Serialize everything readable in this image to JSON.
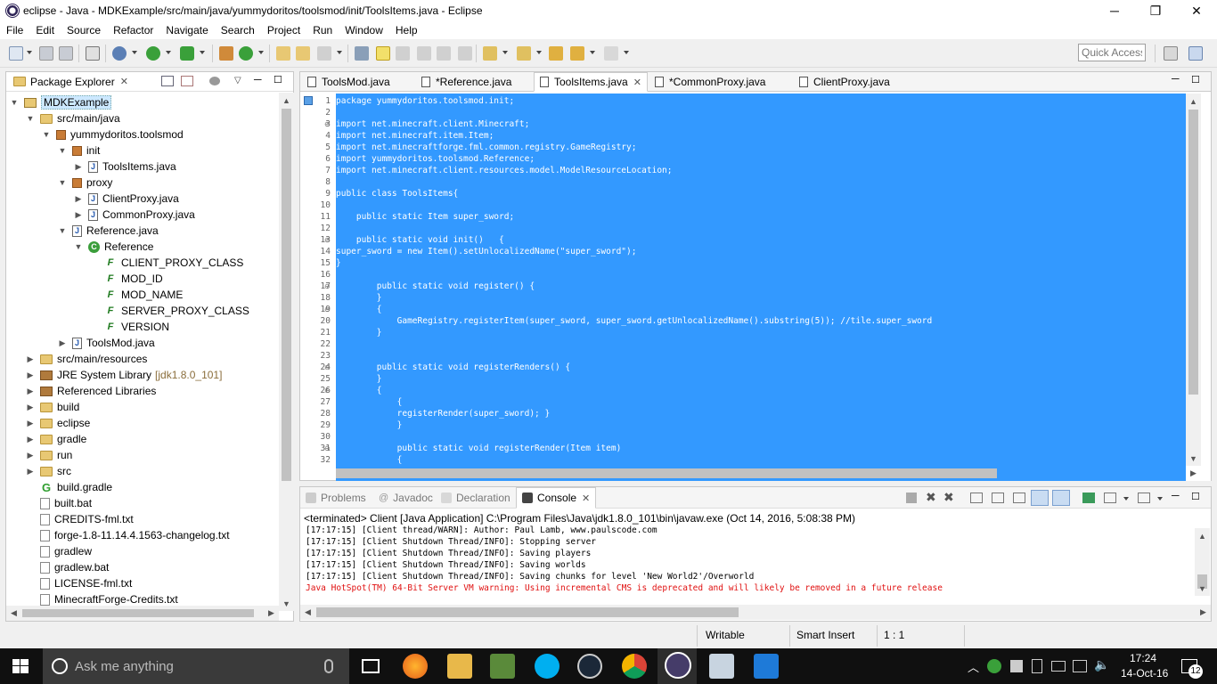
{
  "window": {
    "title": "eclipse - Java - MDKExample/src/main/java/yummydoritos/toolsmod/init/ToolsItems.java - Eclipse",
    "minimize": "─",
    "maximize": "❐",
    "close": "✕"
  },
  "menu": [
    "File",
    "Edit",
    "Source",
    "Refactor",
    "Navigate",
    "Search",
    "Project",
    "Run",
    "Window",
    "Help"
  ],
  "toolbar": {
    "quick_access_placeholder": "Quick Access"
  },
  "package_explorer": {
    "title": "Package Explorer",
    "tree": [
      {
        "label": "MDKExample",
        "icon": "project-icon",
        "expanded": true,
        "selected": true
      },
      {
        "label": "src/main/java",
        "icon": "source-folder-icon",
        "expanded": true
      },
      {
        "label": "yummydoritos.toolsmod",
        "icon": "package-icon",
        "expanded": true
      },
      {
        "label": "init",
        "icon": "package-icon",
        "expanded": true
      },
      {
        "label": "ToolsItems.java",
        "icon": "java-file-icon",
        "expanded": false
      },
      {
        "label": "proxy",
        "icon": "package-icon",
        "expanded": true
      },
      {
        "label": "ClientProxy.java",
        "icon": "java-file-icon",
        "expanded": false
      },
      {
        "label": "CommonProxy.java",
        "icon": "java-file-icon",
        "expanded": false
      },
      {
        "label": "Reference.java",
        "icon": "java-file-icon",
        "expanded": true
      },
      {
        "label": "Reference",
        "icon": "class-icon",
        "expanded": true
      },
      {
        "label": "CLIENT_PROXY_CLASS",
        "icon": "field-icon"
      },
      {
        "label": "MOD_ID",
        "icon": "field-icon"
      },
      {
        "label": "MOD_NAME",
        "icon": "field-icon"
      },
      {
        "label": "SERVER_PROXY_CLASS",
        "icon": "field-icon"
      },
      {
        "label": "VERSION",
        "icon": "field-icon"
      },
      {
        "label": "ToolsMod.java",
        "icon": "java-file-icon",
        "expanded": false
      },
      {
        "label": "src/main/resources",
        "icon": "source-folder-icon",
        "expanded": false
      },
      {
        "label": "JRE System Library",
        "extra": "[jdk1.8.0_101]",
        "icon": "library-icon",
        "expanded": false
      },
      {
        "label": "Referenced Libraries",
        "icon": "library-icon",
        "expanded": false
      },
      {
        "label": "build",
        "icon": "folder-icon",
        "expanded": false
      },
      {
        "label": "eclipse",
        "icon": "folder-icon",
        "expanded": false
      },
      {
        "label": "gradle",
        "icon": "folder-icon",
        "expanded": false
      },
      {
        "label": "run",
        "icon": "folder-icon",
        "expanded": false
      },
      {
        "label": "src",
        "icon": "folder-icon",
        "expanded": false
      },
      {
        "label": "build.gradle",
        "icon": "gradle-icon"
      },
      {
        "label": "built.bat",
        "icon": "file-icon"
      },
      {
        "label": "CREDITS-fml.txt",
        "icon": "file-icon"
      },
      {
        "label": "forge-1.8-11.14.4.1563-changelog.txt",
        "icon": "file-icon"
      },
      {
        "label": "gradlew",
        "icon": "file-icon"
      },
      {
        "label": "gradlew.bat",
        "icon": "file-icon"
      },
      {
        "label": "LICENSE-fml.txt",
        "icon": "file-icon"
      },
      {
        "label": "MinecraftForge-Credits.txt",
        "icon": "file-icon"
      }
    ]
  },
  "editor": {
    "tabs": [
      {
        "label": "ToolsMod.java",
        "active": false
      },
      {
        "label": "*Reference.java",
        "active": false
      },
      {
        "label": "ToolsItems.java",
        "active": true
      },
      {
        "label": "*CommonProxy.java",
        "active": false
      },
      {
        "label": "ClientProxy.java",
        "active": false
      }
    ],
    "lines": [
      {
        "n": "1",
        "text": "package yummydoritos.toolsmod.init;"
      },
      {
        "n": "2",
        "text": ""
      },
      {
        "n": "3",
        "text": "import net.minecraft.client.Minecraft;",
        "fold": true
      },
      {
        "n": "4",
        "text": "import net.minecraft.item.Item;"
      },
      {
        "n": "5",
        "text": "import net.minecraftforge.fml.common.registry.GameRegistry;"
      },
      {
        "n": "6",
        "text": "import yummydoritos.toolsmod.Reference;"
      },
      {
        "n": "7",
        "text": "import net.minecraft.client.resources.model.ModelResourceLocation;"
      },
      {
        "n": "8",
        "text": ""
      },
      {
        "n": "9",
        "text": "public class ToolsItems{"
      },
      {
        "n": "10",
        "text": ""
      },
      {
        "n": "11",
        "text": "    public static Item super_sword;"
      },
      {
        "n": "12",
        "text": ""
      },
      {
        "n": "13",
        "text": "    public static void init()   {",
        "fold": true
      },
      {
        "n": "14",
        "text": "super_sword = new Item().setUnlocalizedName(\"super_sword\");"
      },
      {
        "n": "15",
        "text": "}"
      },
      {
        "n": "16",
        "text": ""
      },
      {
        "n": "17",
        "text": "        public static void register() {",
        "fold": true
      },
      {
        "n": "18",
        "text": "        }"
      },
      {
        "n": "19",
        "text": "        {",
        "fold": true
      },
      {
        "n": "20",
        "text": "            GameRegistry.registerItem(super_sword, super_sword.getUnlocalizedName().substring(5)); //tile.super_sword"
      },
      {
        "n": "21",
        "text": "        }"
      },
      {
        "n": "22",
        "text": ""
      },
      {
        "n": "23",
        "text": ""
      },
      {
        "n": "24",
        "text": "        public static void registerRenders() {",
        "fold": true
      },
      {
        "n": "25",
        "text": "        }"
      },
      {
        "n": "26",
        "text": "        {",
        "fold": true
      },
      {
        "n": "27",
        "text": "            {"
      },
      {
        "n": "28",
        "text": "            registerRender(super_sword); }"
      },
      {
        "n": "29",
        "text": "            }"
      },
      {
        "n": "30",
        "text": ""
      },
      {
        "n": "31",
        "text": "            public static void registerRender(Item item)",
        "fold": true
      },
      {
        "n": "32",
        "text": "            {"
      }
    ]
  },
  "console": {
    "tabs": [
      {
        "label": "Problems",
        "active": false
      },
      {
        "label": "Javadoc",
        "active": false
      },
      {
        "label": "Declaration",
        "active": false
      },
      {
        "label": "Console",
        "active": true
      }
    ],
    "status": "<terminated> Client [Java Application] C:\\Program Files\\Java\\jdk1.8.0_101\\bin\\javaw.exe (Oct 14, 2016, 5:08:38 PM)",
    "lines": [
      {
        "text": "[17:17:15] [Client thread/WARN]: Author: Paul Lamb, www.paulscode.com",
        "color": "#000000"
      },
      {
        "text": "[17:17:15] [Client Shutdown Thread/INFO]: Stopping server",
        "color": "#000000"
      },
      {
        "text": "[17:17:15] [Client Shutdown Thread/INFO]: Saving players",
        "color": "#000000"
      },
      {
        "text": "[17:17:15] [Client Shutdown Thread/INFO]: Saving worlds",
        "color": "#000000"
      },
      {
        "text": "[17:17:15] [Client Shutdown Thread/INFO]: Saving chunks for level 'New World2'/Overworld",
        "color": "#000000"
      },
      {
        "text": "Java HotSpot(TM) 64-Bit Server VM warning: Using incremental CMS is deprecated and will likely be removed in a future release",
        "color": "#e01010"
      }
    ]
  },
  "statusbar": {
    "mode": "Writable",
    "insert": "Smart Insert",
    "position": "1 : 1"
  },
  "taskbar": {
    "search_placeholder": "Ask me anything",
    "time": "17:24",
    "date": "14-Oct-16",
    "notifications": "12"
  },
  "colors": {
    "selection": "#3399ff",
    "taskbar": "#101010",
    "error": "#e01010"
  }
}
